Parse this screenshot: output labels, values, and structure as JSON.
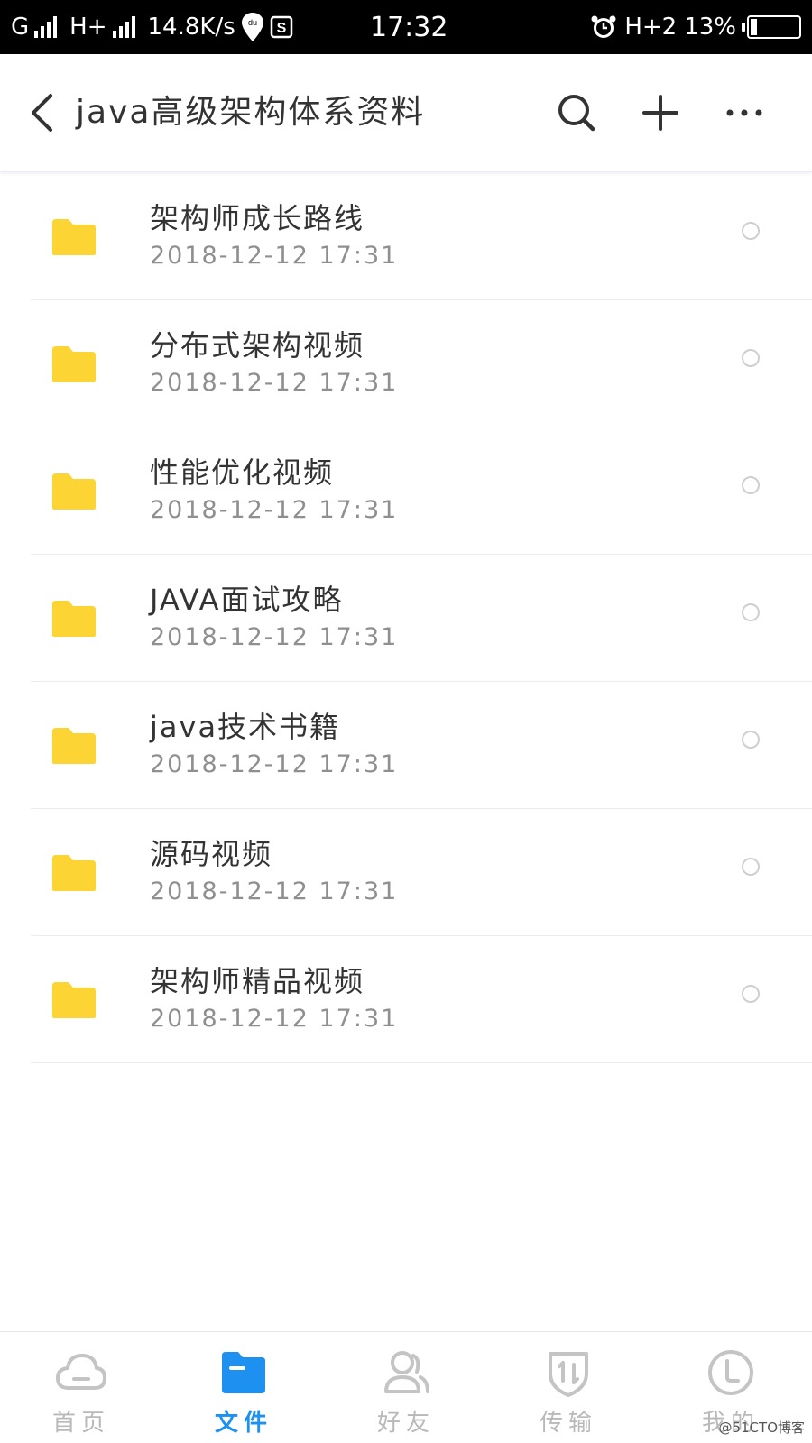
{
  "status_bar": {
    "network1": "G",
    "network2": "H+",
    "speed": "14.8K/s",
    "baidu_badge": "du",
    "s_badge": "S",
    "time": "17:32",
    "network3": "H+2",
    "battery_text": "13%",
    "battery_level": 0.13
  },
  "header": {
    "title": "java高级架构体系资料"
  },
  "files": [
    {
      "name": "架构师成长路线",
      "date": "2018-12-12  17:31"
    },
    {
      "name": "分布式架构视频",
      "date": "2018-12-12  17:31"
    },
    {
      "name": "性能优化视频",
      "date": "2018-12-12  17:31"
    },
    {
      "name": "JAVA面试攻略",
      "date": "2018-12-12  17:31"
    },
    {
      "name": "java技术书籍",
      "date": "2018-12-12  17:31"
    },
    {
      "name": "源码视频",
      "date": "2018-12-12  17:31"
    },
    {
      "name": "架构师精品视频",
      "date": "2018-12-12  17:31"
    }
  ],
  "nav": {
    "home": "首页",
    "files": "文件",
    "friends": "好友",
    "transfer": "传输",
    "mine": "我的",
    "active": "files"
  },
  "watermark": "@51CTO博客",
  "colors": {
    "accent": "#1e90f0",
    "folder": "#fcd535",
    "inactive": "#b9b9b9"
  }
}
